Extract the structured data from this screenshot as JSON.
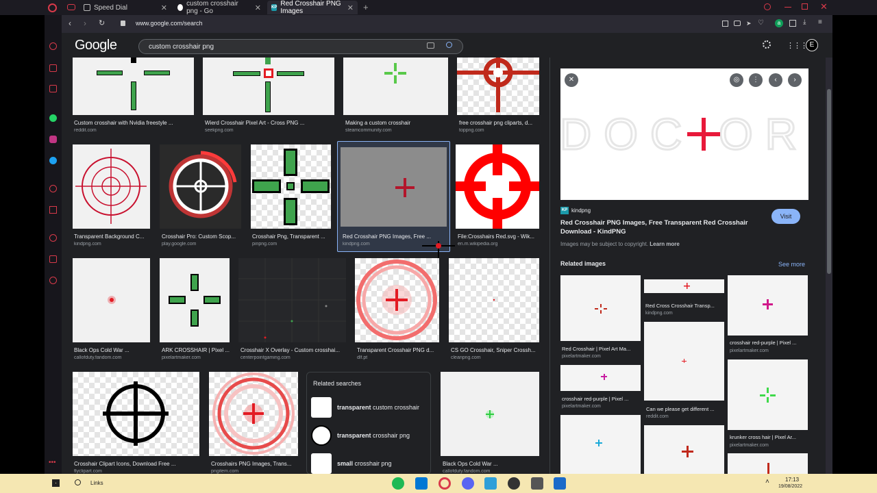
{
  "tabs": [
    {
      "title": "Speed Dial",
      "close": "✕"
    },
    {
      "title": "custom crosshair png - Go",
      "close": "✕"
    },
    {
      "title": "Red Crosshair PNG Images",
      "close": "✕"
    }
  ],
  "new_tab": "+",
  "address": "www.google.com/search",
  "google": {
    "logo": "Google",
    "query": "custom crosshair png",
    "avatar": "E"
  },
  "grid": [
    {
      "caption": "Custom crosshair with Nvidia freestyle ...",
      "source": "reddit.com"
    },
    {
      "caption": "Wierd Crosshair Pixel Art - Cross PNG ...",
      "source": "seekpng.com"
    },
    {
      "caption": "Making a custom crosshair",
      "source": "steamcommunity.com"
    },
    {
      "caption": "free crosshair png cliparts, d...",
      "source": "toppng.com"
    },
    {
      "caption": "Transparent Background C...",
      "source": "kindpng.com"
    },
    {
      "caption": "Crosshair Pro: Custom Scop...",
      "source": "play.google.com"
    },
    {
      "caption": "Crosshair Png, Transparent ...",
      "source": "pinpng.com"
    },
    {
      "caption": "Red Crosshair PNG Images, Free ...",
      "source": "kindpng.com"
    },
    {
      "caption": "File:Crosshairs Red.svg - Wik...",
      "source": "en.m.wikipedia.org"
    },
    {
      "caption": "Black Ops Cold War ...",
      "source": "callofduty.fandom.com"
    },
    {
      "caption": "ARK CROSSHAIR | Pixel ...",
      "source": "pixelartmaker.com"
    },
    {
      "caption": "Crosshair X Overlay - Custom crosshai...",
      "source": "centerpointgaming.com"
    },
    {
      "caption": "Transparent Crosshair PNG d...",
      "source": "dlf.pt"
    },
    {
      "caption": "CS GO Crosshair, Sniper Crossh...",
      "source": "cleanpng.com"
    },
    {
      "caption": "Crosshair Clipart Icons, Download Free ...",
      "source": "flyclipart.com"
    },
    {
      "caption": "Crosshairs PNG Images, Trans...",
      "source": "pngitem.com"
    },
    {
      "caption": "Black Ops Cold War ...",
      "source": "callofduty.fandom.com"
    }
  ],
  "related_searches": {
    "title": "Related searches",
    "items": [
      {
        "bold": "transparent",
        "rest": " custom crosshair"
      },
      {
        "bold": "transparent",
        "rest": " crosshair png"
      },
      {
        "bold": "small",
        "rest": " crosshair png"
      }
    ]
  },
  "panel": {
    "close": "✕",
    "preview_text": "DOC OR",
    "site_badge": "KP",
    "site": "kindpng",
    "title_line1": "Red Crosshair PNG Images, Free Transparent Red Crosshair",
    "title_line2": "Download - KindPNG",
    "visit": "Visit",
    "copyright": "Images may be subject to copyright.",
    "learn_more": "Learn more",
    "related_title": "Related images",
    "see_more": "See more",
    "related": [
      {
        "caption": "Red Crosshair | Pixel Art Ma...",
        "source": "pixelartmaker.com"
      },
      {
        "caption": "Red Cross Crosshair Transp...",
        "source": "kindpng.com"
      },
      {
        "caption": "crosshair red-purple | Pixel ...",
        "source": "pixelartmaker.com"
      },
      {
        "caption": "crosshair red-purple | Pixel ...",
        "source": "pixelartmaker.com"
      },
      {
        "caption": "Can we please get different ...",
        "source": "reddit.com"
      },
      {
        "caption": "krunker cross hair | Pixel Ar...",
        "source": "pixelartmaker.com"
      }
    ]
  },
  "taskbar": {
    "search": "Links",
    "time": "17:13",
    "date": "19/08/2022"
  },
  "colors": {
    "accent": "#8ab4f8",
    "crosshair_red": "#e31b23",
    "crosshair_green": "#3fa34d",
    "taskbar": "#f5e7b2"
  }
}
